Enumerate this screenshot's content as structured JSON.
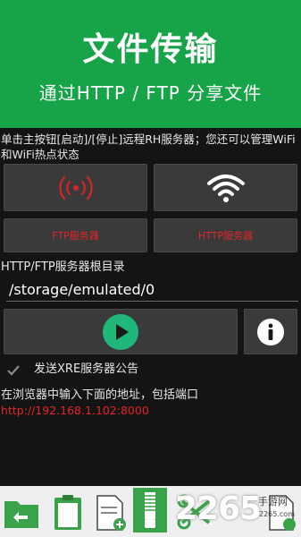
{
  "hero": {
    "title": "文件传输",
    "subtitle": "通过HTTP / FTP 分享文件"
  },
  "info_text": "单击主按钮[启动]/[停止]远程RH服务器；您还可以管理WiFi和WiFi热点状态",
  "buttons": {
    "ftp_label": "FTP服务器",
    "http_label": "HTTP服务器"
  },
  "root_dir": {
    "label": "HTTP/FTP服务器根目录",
    "value": "/storage/emulated/0"
  },
  "broadcast": {
    "label": "发送XRE服务器公告",
    "checked": true
  },
  "instructions": "在浏览器中输入下面的地址，包括端口",
  "server_url": "http://192.168.1.102:8000",
  "watermark": {
    "text": "2265",
    "sub": "手游网",
    "url": "2265.com"
  },
  "colors": {
    "hero_bg": "#17a448",
    "accent_red": "#e0262a",
    "play_green": "#1fb87a"
  },
  "toolbar": {
    "icons": [
      "back-folder-icon",
      "clipboard-icon",
      "new-file-icon",
      "zip-icon",
      "scissors-icon",
      "file-copy-icon"
    ]
  }
}
